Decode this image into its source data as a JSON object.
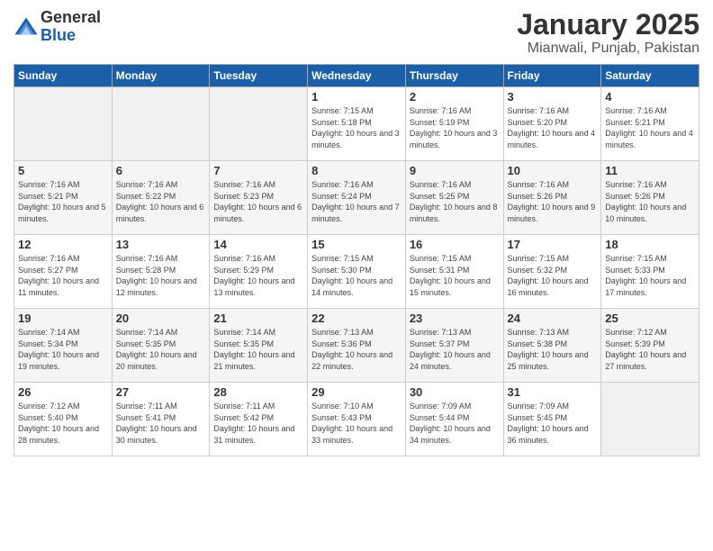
{
  "logo": {
    "general": "General",
    "blue": "Blue"
  },
  "title": "January 2025",
  "subtitle": "Mianwali, Punjab, Pakistan",
  "days_of_week": [
    "Sunday",
    "Monday",
    "Tuesday",
    "Wednesday",
    "Thursday",
    "Friday",
    "Saturday"
  ],
  "weeks": [
    [
      {
        "num": "",
        "sunrise": "",
        "sunset": "",
        "daylight": "",
        "empty": true
      },
      {
        "num": "",
        "sunrise": "",
        "sunset": "",
        "daylight": "",
        "empty": true
      },
      {
        "num": "",
        "sunrise": "",
        "sunset": "",
        "daylight": "",
        "empty": true
      },
      {
        "num": "1",
        "sunrise": "Sunrise: 7:15 AM",
        "sunset": "Sunset: 5:18 PM",
        "daylight": "Daylight: 10 hours and 3 minutes."
      },
      {
        "num": "2",
        "sunrise": "Sunrise: 7:16 AM",
        "sunset": "Sunset: 5:19 PM",
        "daylight": "Daylight: 10 hours and 3 minutes."
      },
      {
        "num": "3",
        "sunrise": "Sunrise: 7:16 AM",
        "sunset": "Sunset: 5:20 PM",
        "daylight": "Daylight: 10 hours and 4 minutes."
      },
      {
        "num": "4",
        "sunrise": "Sunrise: 7:16 AM",
        "sunset": "Sunset: 5:21 PM",
        "daylight": "Daylight: 10 hours and 4 minutes."
      }
    ],
    [
      {
        "num": "5",
        "sunrise": "Sunrise: 7:16 AM",
        "sunset": "Sunset: 5:21 PM",
        "daylight": "Daylight: 10 hours and 5 minutes."
      },
      {
        "num": "6",
        "sunrise": "Sunrise: 7:16 AM",
        "sunset": "Sunset: 5:22 PM",
        "daylight": "Daylight: 10 hours and 6 minutes."
      },
      {
        "num": "7",
        "sunrise": "Sunrise: 7:16 AM",
        "sunset": "Sunset: 5:23 PM",
        "daylight": "Daylight: 10 hours and 6 minutes."
      },
      {
        "num": "8",
        "sunrise": "Sunrise: 7:16 AM",
        "sunset": "Sunset: 5:24 PM",
        "daylight": "Daylight: 10 hours and 7 minutes."
      },
      {
        "num": "9",
        "sunrise": "Sunrise: 7:16 AM",
        "sunset": "Sunset: 5:25 PM",
        "daylight": "Daylight: 10 hours and 8 minutes."
      },
      {
        "num": "10",
        "sunrise": "Sunrise: 7:16 AM",
        "sunset": "Sunset: 5:26 PM",
        "daylight": "Daylight: 10 hours and 9 minutes."
      },
      {
        "num": "11",
        "sunrise": "Sunrise: 7:16 AM",
        "sunset": "Sunset: 5:26 PM",
        "daylight": "Daylight: 10 hours and 10 minutes."
      }
    ],
    [
      {
        "num": "12",
        "sunrise": "Sunrise: 7:16 AM",
        "sunset": "Sunset: 5:27 PM",
        "daylight": "Daylight: 10 hours and 11 minutes."
      },
      {
        "num": "13",
        "sunrise": "Sunrise: 7:16 AM",
        "sunset": "Sunset: 5:28 PM",
        "daylight": "Daylight: 10 hours and 12 minutes."
      },
      {
        "num": "14",
        "sunrise": "Sunrise: 7:16 AM",
        "sunset": "Sunset: 5:29 PM",
        "daylight": "Daylight: 10 hours and 13 minutes."
      },
      {
        "num": "15",
        "sunrise": "Sunrise: 7:15 AM",
        "sunset": "Sunset: 5:30 PM",
        "daylight": "Daylight: 10 hours and 14 minutes."
      },
      {
        "num": "16",
        "sunrise": "Sunrise: 7:15 AM",
        "sunset": "Sunset: 5:31 PM",
        "daylight": "Daylight: 10 hours and 15 minutes."
      },
      {
        "num": "17",
        "sunrise": "Sunrise: 7:15 AM",
        "sunset": "Sunset: 5:32 PM",
        "daylight": "Daylight: 10 hours and 16 minutes."
      },
      {
        "num": "18",
        "sunrise": "Sunrise: 7:15 AM",
        "sunset": "Sunset: 5:33 PM",
        "daylight": "Daylight: 10 hours and 17 minutes."
      }
    ],
    [
      {
        "num": "19",
        "sunrise": "Sunrise: 7:14 AM",
        "sunset": "Sunset: 5:34 PM",
        "daylight": "Daylight: 10 hours and 19 minutes."
      },
      {
        "num": "20",
        "sunrise": "Sunrise: 7:14 AM",
        "sunset": "Sunset: 5:35 PM",
        "daylight": "Daylight: 10 hours and 20 minutes."
      },
      {
        "num": "21",
        "sunrise": "Sunrise: 7:14 AM",
        "sunset": "Sunset: 5:35 PM",
        "daylight": "Daylight: 10 hours and 21 minutes."
      },
      {
        "num": "22",
        "sunrise": "Sunrise: 7:13 AM",
        "sunset": "Sunset: 5:36 PM",
        "daylight": "Daylight: 10 hours and 22 minutes."
      },
      {
        "num": "23",
        "sunrise": "Sunrise: 7:13 AM",
        "sunset": "Sunset: 5:37 PM",
        "daylight": "Daylight: 10 hours and 24 minutes."
      },
      {
        "num": "24",
        "sunrise": "Sunrise: 7:13 AM",
        "sunset": "Sunset: 5:38 PM",
        "daylight": "Daylight: 10 hours and 25 minutes."
      },
      {
        "num": "25",
        "sunrise": "Sunrise: 7:12 AM",
        "sunset": "Sunset: 5:39 PM",
        "daylight": "Daylight: 10 hours and 27 minutes."
      }
    ],
    [
      {
        "num": "26",
        "sunrise": "Sunrise: 7:12 AM",
        "sunset": "Sunset: 5:40 PM",
        "daylight": "Daylight: 10 hours and 28 minutes."
      },
      {
        "num": "27",
        "sunrise": "Sunrise: 7:11 AM",
        "sunset": "Sunset: 5:41 PM",
        "daylight": "Daylight: 10 hours and 30 minutes."
      },
      {
        "num": "28",
        "sunrise": "Sunrise: 7:11 AM",
        "sunset": "Sunset: 5:42 PM",
        "daylight": "Daylight: 10 hours and 31 minutes."
      },
      {
        "num": "29",
        "sunrise": "Sunrise: 7:10 AM",
        "sunset": "Sunset: 5:43 PM",
        "daylight": "Daylight: 10 hours and 33 minutes."
      },
      {
        "num": "30",
        "sunrise": "Sunrise: 7:09 AM",
        "sunset": "Sunset: 5:44 PM",
        "daylight": "Daylight: 10 hours and 34 minutes."
      },
      {
        "num": "31",
        "sunrise": "Sunrise: 7:09 AM",
        "sunset": "Sunset: 5:45 PM",
        "daylight": "Daylight: 10 hours and 36 minutes."
      },
      {
        "num": "",
        "sunrise": "",
        "sunset": "",
        "daylight": "",
        "empty": true
      }
    ]
  ]
}
